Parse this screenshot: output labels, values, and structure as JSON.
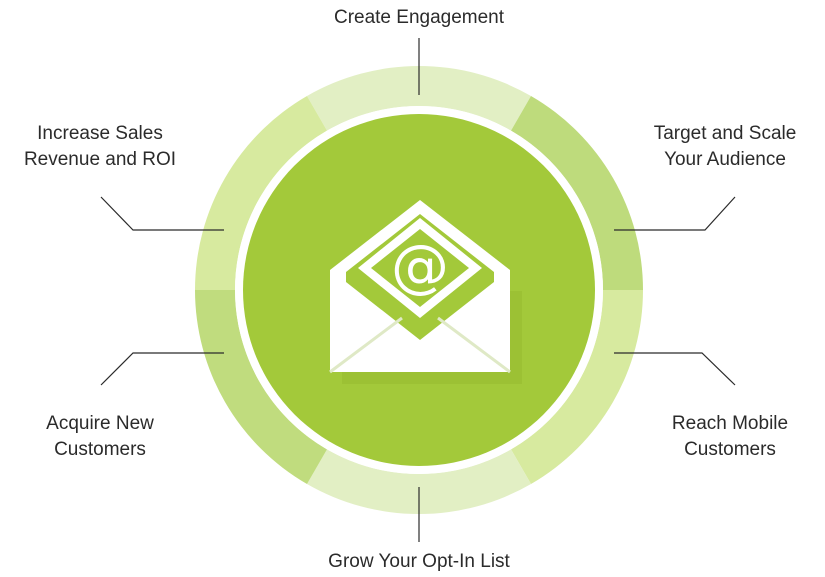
{
  "center": {
    "icon": "email-envelope-at-icon",
    "symbol": "@"
  },
  "segments": [
    {
      "id": "create-engagement",
      "lines": [
        "Create Engagement"
      ],
      "color": "#e2efc4"
    },
    {
      "id": "target-and-scale",
      "lines": [
        "Target and Scale",
        "Your Audience"
      ],
      "color": "#bedb7c"
    },
    {
      "id": "reach-mobile",
      "lines": [
        "Reach Mobile",
        "Customers"
      ],
      "color": "#d7ea9f"
    },
    {
      "id": "grow-opt-in",
      "lines": [
        "Grow Your Opt-In List"
      ],
      "color": "#e2efc4"
    },
    {
      "id": "acquire-new",
      "lines": [
        "Acquire New",
        "Customers"
      ],
      "color": "#c0dc7e"
    },
    {
      "id": "increase-sales",
      "lines": [
        "Increase Sales",
        "Revenue and ROI"
      ],
      "color": "#d7ea9f"
    }
  ],
  "colors": {
    "inner_circle": "#a3c93a",
    "inner_circle_shadow": "#93b92f",
    "ring_gap": "#ffffff",
    "envelope": "#ffffff",
    "leader_line": "#2b2b2b",
    "text": "#2b2b2b"
  }
}
